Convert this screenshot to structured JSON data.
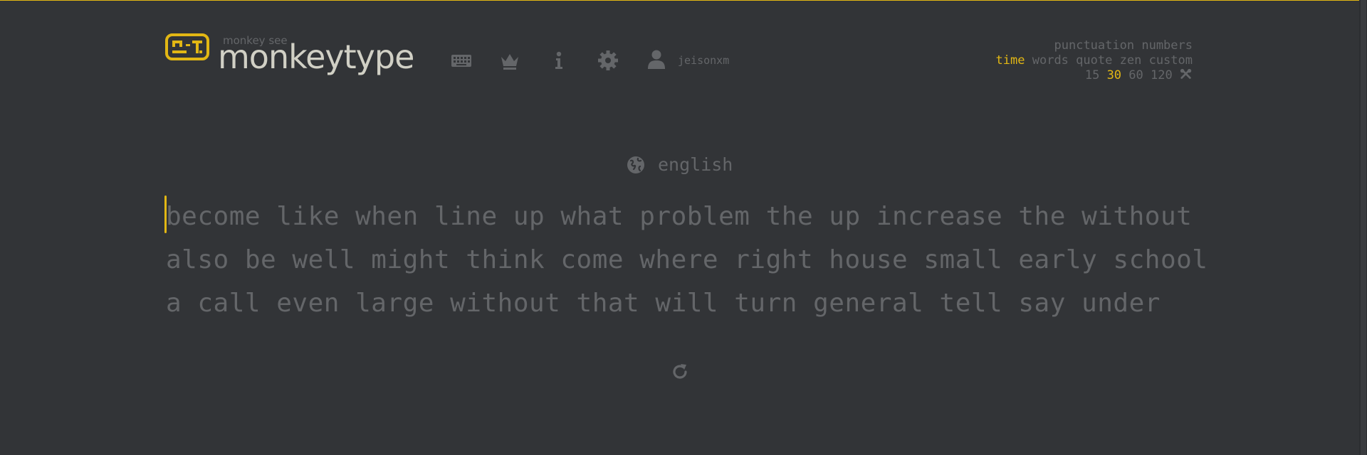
{
  "logo": {
    "top_text": "monkey see",
    "title": "monkeytype"
  },
  "nav": {
    "icons": [
      "keyboard-icon",
      "crown-icon",
      "info-icon",
      "gear-icon",
      "user-icon"
    ],
    "username": "jeisonxm"
  },
  "config": {
    "row1": [
      "punctuation",
      "numbers"
    ],
    "row2": [
      "time",
      "words",
      "quote",
      "zen",
      "custom"
    ],
    "row2_active": "time",
    "row3": [
      "15",
      "30",
      "60",
      "120"
    ],
    "row3_active": "30",
    "row3_icon": "tools-icon"
  },
  "language": {
    "icon": "globe-icon",
    "label": "english"
  },
  "words": {
    "lines": [
      "become like when line up what problem the up increase the without",
      "also be well might think come where right house small early school",
      "a call even large without that will turn general tell say under"
    ]
  },
  "restart_icon": "restart-icon",
  "colors": {
    "background": "#323437",
    "accent": "#e2b714",
    "text": "#d1d0c5",
    "sub": "#646669"
  }
}
